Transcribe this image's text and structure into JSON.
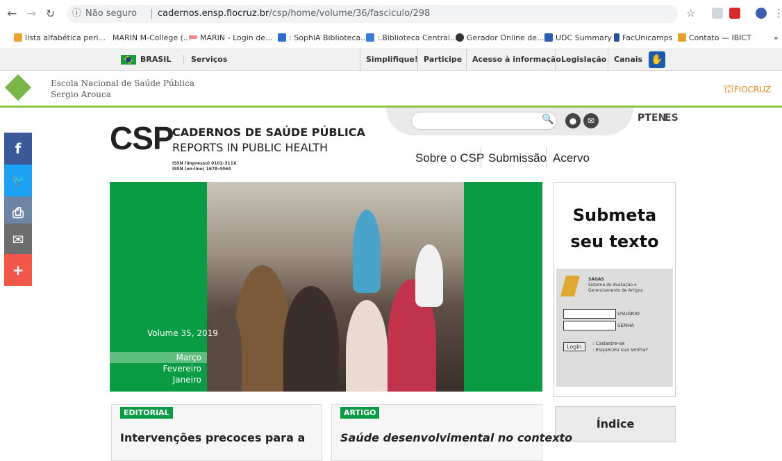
{
  "browser": {
    "security_label": "Não seguro",
    "url_host": "cadernos.ensp.fiocruz.br",
    "url_path": "/csp/home/volume/36/fasciculo/298",
    "bookmarks": [
      "lista alfabética peri...",
      "MARIN M-College (...",
      "MARIN - Login de...",
      ": SophiA Biblioteca...",
      ":.Biblioteca Central...",
      "Gerador Online de...",
      "UDC Summary",
      "FacUnicamps",
      "Contato — IBICT"
    ],
    "more": "»"
  },
  "govbar": {
    "brasil": "BRASIL",
    "servicos": "Serviços",
    "links": [
      "Simplifique!",
      "Participe",
      "Acesso à informação",
      "Legislação",
      "Canais"
    ]
  },
  "ensp": {
    "line1": "Escola Nacional de Saúde Pública",
    "line2": "Sergio Arouca",
    "fiocruz": "FIOCRUZ"
  },
  "social": [
    {
      "icon": "facebook-icon",
      "glyph": "f",
      "color": "#3b5998"
    },
    {
      "icon": "twitter-icon",
      "glyph": "🐦",
      "color": "#1da1f2"
    },
    {
      "icon": "print-icon",
      "glyph": "⎙",
      "color": "#6d84a4"
    },
    {
      "icon": "email-icon",
      "glyph": "✉",
      "color": "#6d6d6d"
    },
    {
      "icon": "plus-icon",
      "glyph": "+",
      "color": "#f1574a"
    }
  ],
  "search": {
    "placeholder": ""
  },
  "lang": {
    "pt": "PT",
    "en": "EN",
    "es": "ES"
  },
  "csp": {
    "abbr": "CSP",
    "title": "CADERNOS DE SAÚDE PÚBLICA",
    "subtitle": "REPORTS IN PUBLIC HEALTH",
    "issn1": "ISSN (impresso) 0102-311X",
    "issn2": "ISSN (on-line) 1678-4464"
  },
  "nav": [
    "Sobre o CSP",
    "Submissão",
    "Acervo"
  ],
  "hero": {
    "volume": "Volume 35, 2019",
    "months": [
      "Março",
      "Fevereiro",
      "Janeiro"
    ]
  },
  "submit": {
    "title": "Submeta seu texto",
    "sagas": "SAGAS",
    "sagas_desc1": "Sistema de Avaliação e",
    "sagas_desc2": "Gerenciamento de Artigos",
    "user_label": "USUÁRIO",
    "pass_label": "SENHA",
    "login": "Login",
    "register": ": Cadastre-se",
    "forgot": ": Esqueceu sua senha?"
  },
  "indice": "Índice",
  "articles": [
    {
      "tag": "EDITORIAL",
      "title": "Intervenções precoces para a"
    },
    {
      "tag": "ARTIGO",
      "title": "Saúde desenvolvimental no contexto"
    }
  ]
}
